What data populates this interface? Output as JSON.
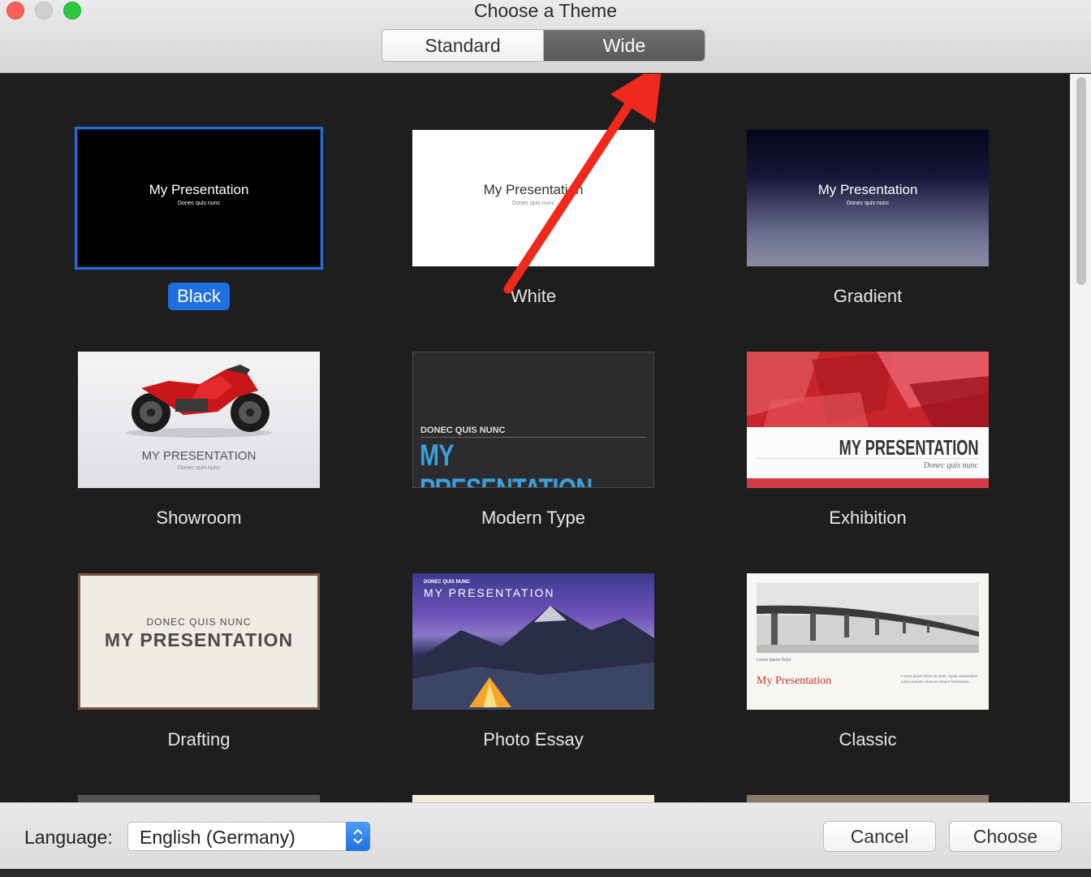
{
  "window": {
    "title": "Choose a Theme"
  },
  "segmented": {
    "standard_label": "Standard",
    "wide_label": "Wide",
    "selected": "Wide"
  },
  "themes": [
    {
      "name": "Black",
      "title": "My Presentation",
      "subtitle": "Donec quis nunc",
      "selected": true
    },
    {
      "name": "White",
      "title": "My Presentation",
      "subtitle": "Donec quis nunc"
    },
    {
      "name": "Gradient",
      "title": "My Presentation",
      "subtitle": "Donec quis nunc"
    },
    {
      "name": "Showroom",
      "title": "MY PRESENTATION",
      "subtitle": "Donec quis nunc"
    },
    {
      "name": "Modern Type",
      "kicker": "DONEC QUIS NUNC",
      "title": "MY PRESENTATION"
    },
    {
      "name": "Exhibition",
      "title": "MY PRESENTATION",
      "subtitle": "Donec quis nunc"
    },
    {
      "name": "Drafting",
      "kicker": "DONEC QUIS NUNC",
      "title": "MY PRESENTATION"
    },
    {
      "name": "Photo Essay",
      "kicker": "DONEC QUIS NUNC",
      "title": "MY PRESENTATION"
    },
    {
      "name": "Classic",
      "title": "My Presentation",
      "caption": "Lorem Ipsum Dolor",
      "body": "Lorem ipsum dolor sit amet, ligula suspendisse nulla pretium, rhoncus tempor fermentum."
    }
  ],
  "bottom": {
    "language_label": "Language:",
    "language_value": "English (Germany)",
    "cancel_label": "Cancel",
    "choose_label": "Choose"
  },
  "colors": {
    "accent": "#1f6fe0",
    "annotation_arrow": "#f0291c"
  }
}
